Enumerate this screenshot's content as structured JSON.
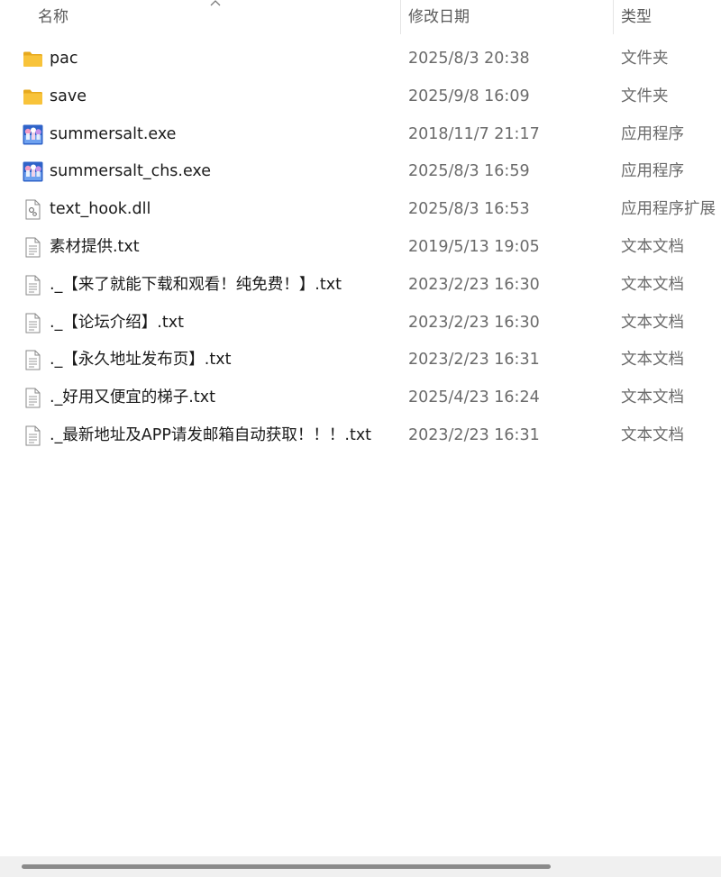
{
  "header": {
    "name_label": "名称",
    "date_label": "修改日期",
    "type_label": "类型"
  },
  "files": [
    {
      "name": "pac",
      "date": "2025/8/3 20:38",
      "type": "文件夹",
      "icon": "folder-icon"
    },
    {
      "name": "save",
      "date": "2025/9/8 16:09",
      "type": "文件夹",
      "icon": "folder-icon"
    },
    {
      "name": "summersalt.exe",
      "date": "2018/11/7 21:17",
      "type": "应用程序",
      "icon": "app-icon"
    },
    {
      "name": "summersalt_chs.exe",
      "date": "2025/8/3 16:59",
      "type": "应用程序",
      "icon": "app-icon"
    },
    {
      "name": "text_hook.dll",
      "date": "2025/8/3 16:53",
      "type": "应用程序扩展",
      "icon": "dll-icon"
    },
    {
      "name": "素材提供.txt",
      "date": "2019/5/13 19:05",
      "type": "文本文档",
      "icon": "text-file-icon"
    },
    {
      "name": "._【来了就能下载和观看！纯免费！】.txt",
      "date": "2023/2/23 16:30",
      "type": "文本文档",
      "icon": "text-file-icon"
    },
    {
      "name": "._【论坛介绍】.txt",
      "date": "2023/2/23 16:30",
      "type": "文本文档",
      "icon": "text-file-icon"
    },
    {
      "name": "._【永久地址发布页】.txt",
      "date": "2023/2/23 16:31",
      "type": "文本文档",
      "icon": "text-file-icon"
    },
    {
      "name": "._好用又便宜的梯子.txt",
      "date": "2025/4/23 16:24",
      "type": "文本文档",
      "icon": "text-file-icon"
    },
    {
      "name": "._最新地址及APP请发邮箱自动获取！！！.txt",
      "date": "2023/2/23 16:31",
      "type": "文本文档",
      "icon": "text-file-icon"
    }
  ],
  "colors": {
    "folder": "#f8c33a",
    "folder_dark": "#e7a91d",
    "app_blue": "#2f63c9",
    "text_primary": "#1a1a1a",
    "text_secondary": "#6b6b6b"
  }
}
